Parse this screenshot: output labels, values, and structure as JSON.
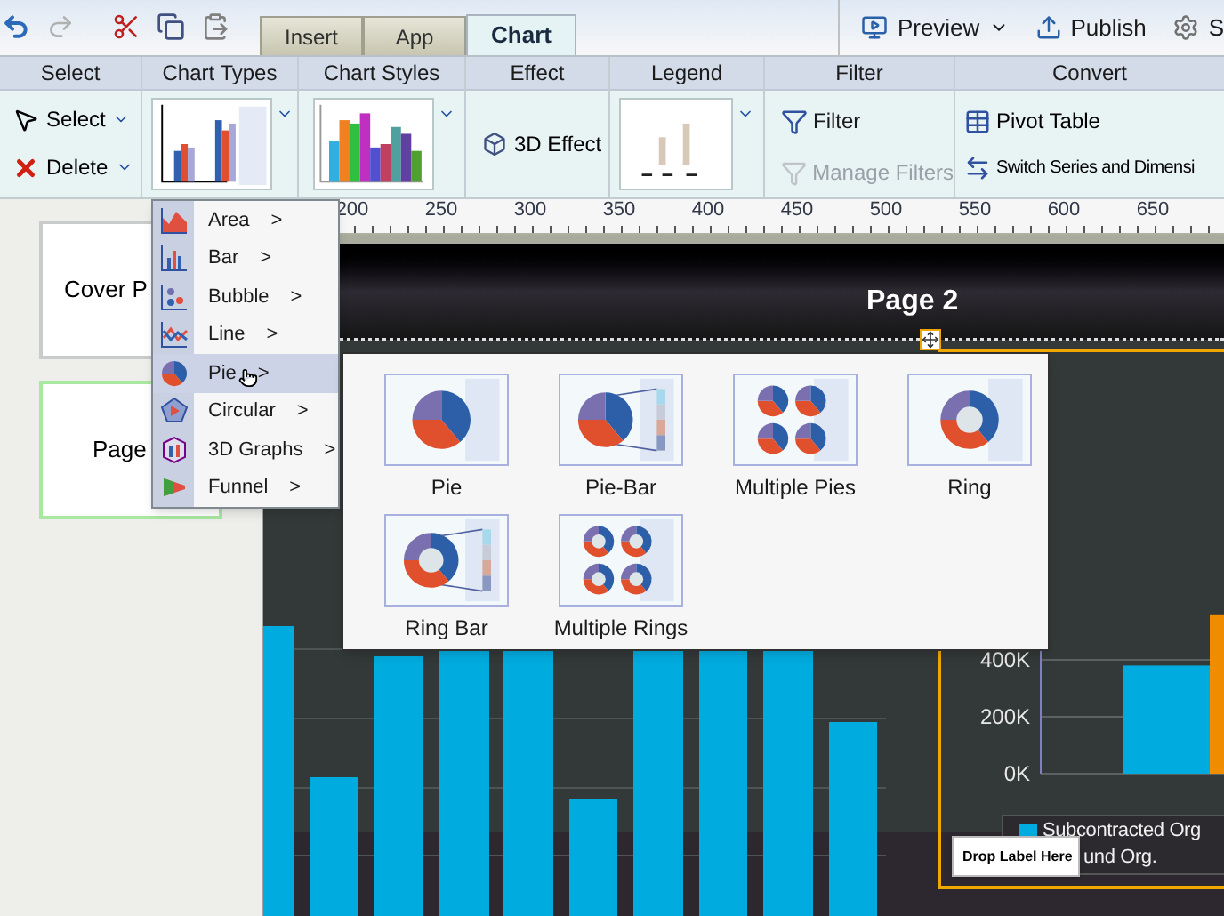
{
  "toolbar": {
    "tabs": [
      {
        "label": "Insert",
        "selected": false
      },
      {
        "label": "App",
        "selected": false
      },
      {
        "label": "Chart",
        "selected": true
      }
    ],
    "actions": [
      {
        "label": "Preview",
        "kind": "preview"
      },
      {
        "label": "Publish",
        "kind": "publish"
      },
      {
        "label": "S",
        "kind": "settings"
      }
    ]
  },
  "ribbon": {
    "select": {
      "title": "Select",
      "items": [
        {
          "label": "Select",
          "kind": "pointer"
        },
        {
          "label": "Delete",
          "kind": "delete"
        }
      ]
    },
    "chart_types": {
      "title": "Chart Types"
    },
    "chart_styles": {
      "title": "Chart Styles"
    },
    "effect": {
      "title": "Effect",
      "button": "3D Effect"
    },
    "legend": {
      "title": "Legend"
    },
    "filter": {
      "title": "Filter",
      "items": [
        {
          "label": "Filter",
          "disabled": false
        },
        {
          "label": "Manage Filters",
          "disabled": true
        }
      ]
    },
    "convert": {
      "title": "Convert",
      "items": [
        {
          "label": "Pivot Table",
          "kind": "table"
        },
        {
          "label": "Switch Series and Dimensi",
          "kind": "switch"
        }
      ]
    }
  },
  "pages": [
    {
      "label": "Cover P",
      "selected": false
    },
    {
      "label": "Page",
      "selected": true
    }
  ],
  "ruler": [
    "200",
    "250",
    "300",
    "350",
    "400",
    "450",
    "500",
    "550",
    "600",
    "650"
  ],
  "canvas": {
    "title": "Page 2",
    "right_chart": {
      "chart_data": {
        "type": "bar",
        "ylim": [
          0,
          600000
        ],
        "yticks": [
          {
            "value": 0,
            "label": "0K"
          },
          {
            "value": 200000,
            "label": "200K"
          },
          {
            "value": 400000,
            "label": "400K"
          }
        ],
        "series": [
          {
            "name": "Subcontracted Org",
            "color": "#00acdf",
            "values": [
              380000
            ]
          },
          {
            "name": "und Org.",
            "color": "#f08c00",
            "values": [
              560000
            ]
          }
        ]
      },
      "legend_swatches": [
        true,
        false
      ]
    },
    "drop_label": "Drop Label Here"
  },
  "chart_type_menu": [
    {
      "label": "Area",
      "arrow": ">",
      "kind": "area",
      "selected": false
    },
    {
      "label": "Bar",
      "arrow": ">",
      "kind": "bar",
      "selected": false
    },
    {
      "label": "Bubble",
      "arrow": ">",
      "kind": "bubble",
      "selected": false
    },
    {
      "label": "Line",
      "arrow": ">",
      "kind": "line",
      "selected": false
    },
    {
      "label": "Pie",
      "arrow": ">",
      "kind": "pie",
      "selected": true
    },
    {
      "label": "Circular",
      "arrow": ">",
      "kind": "circular",
      "selected": false
    },
    {
      "label": "3D Graphs",
      "arrow": ">",
      "kind": "cube",
      "selected": false
    },
    {
      "label": "Funnel",
      "arrow": ">",
      "kind": "funnel",
      "selected": false
    }
  ],
  "pie_types": [
    {
      "label": "Pie",
      "kind": "pie"
    },
    {
      "label": "Pie-Bar",
      "kind": "pie-bar"
    },
    {
      "label": "Multiple Pies",
      "kind": "multiple-pies"
    },
    {
      "label": "Ring",
      "kind": "ring"
    },
    {
      "label": "Ring Bar",
      "kind": "ring-bar"
    },
    {
      "label": "Multiple Rings",
      "kind": "multiple-rings"
    }
  ]
}
